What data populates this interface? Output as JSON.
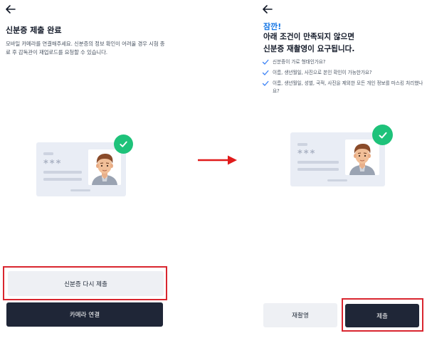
{
  "left_screen": {
    "title": "신분증 제출 완료",
    "description": "모바일 카메라를 연결해주세요. 신분증의 정보 확인이 어려울 경우 시험 종료 후 감독관이 재업로드를 요청할 수 있습니다.",
    "id_card_masked_text": "***",
    "resubmit_button": "신분증 다시 제출",
    "connect_camera_button": "카메라 연결"
  },
  "right_screen": {
    "alert_word": "잠깐!",
    "headline_line1": "아래 조건이 만족되지 않으면",
    "headline_line2": "신분증 재촬영이 요구됩니다.",
    "checklist": [
      "신분증이 가로 형태인가요?",
      "이름, 생년월일, 사진으로 본인 확인이 가능한가요?",
      "이름, 생년월일, 성별, 국적, 사진을 제외한 모든 개인 정보를 마스킹 처리했나요?"
    ],
    "id_card_masked_text": "***",
    "retake_button": "재촬영",
    "submit_button": "제출"
  },
  "colors": {
    "accent_blue": "#1677e6",
    "check_blue": "#3b82f6",
    "verified_green": "#1ec27a",
    "highlight_red": "#d9262f",
    "dark_button": "#1f2637",
    "light_button": "#eef0f4",
    "card_bg": "#e9edf5"
  },
  "icons": {
    "back": "arrow-left-icon",
    "check": "check-icon",
    "verified": "check-circle-icon",
    "transition": "arrow-right-icon"
  }
}
